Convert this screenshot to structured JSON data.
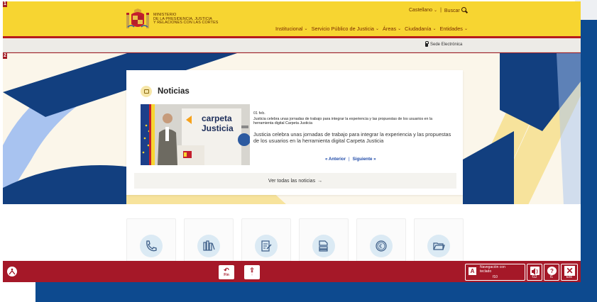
{
  "markers": {
    "header": "1",
    "hero": "2"
  },
  "header": {
    "ministry_lines": [
      "MINISTERIO",
      "DE LA PRESIDENCIA, JUSTICIA",
      "Y RELACIONES CON LAS CORTES"
    ],
    "language": "Castellano",
    "search_label": "Buscar",
    "nav": [
      "Institucional",
      "Servicio Público de Justicia",
      "Áreas",
      "Ciudadanía",
      "Entidades"
    ]
  },
  "sede": {
    "label": "Sede Electrónica"
  },
  "news": {
    "title": "Noticias",
    "date": "01 feb.",
    "short": "Justicia celebra unas jornadas de trabajo para integrar la experiencia y las propuestas de los usuarios en la herramienta digital Carpeta Justicia",
    "long": "Justicia celebra unas jornadas de trabajo para integrar la experiencia y las propuestas de los usuarios en la herramienta digital Carpeta Justicia",
    "photo_text": [
      "carpeta",
      "Justicia"
    ],
    "prev": "« Anterior",
    "next": "Siguiente »",
    "all": "Ver todas las noticias",
    "all_arrow": "→"
  },
  "services": [
    {
      "icon": "phone-icon"
    },
    {
      "icon": "books-icon"
    },
    {
      "icon": "document-edit-icon"
    },
    {
      "icon": "documents-stack-icon"
    },
    {
      "icon": "euro-icon"
    },
    {
      "icon": "folder-icon"
    }
  ],
  "toolbar": {
    "fin_label": "Fin",
    "up_label": "↑",
    "keyboard_nav_line1": "Navegación con",
    "keyboard_nav_line2": "teclado",
    "keyboard_key": "f10",
    "audio_key": "f12",
    "help_key": "f1",
    "close_key": "Esc"
  },
  "colors": {
    "header_yellow": "#f7d531",
    "brand_red": "#a51828",
    "navy": "#0d4a8f",
    "light_blue": "#a8c3f0",
    "hero_yellow": "#f7e39c"
  }
}
